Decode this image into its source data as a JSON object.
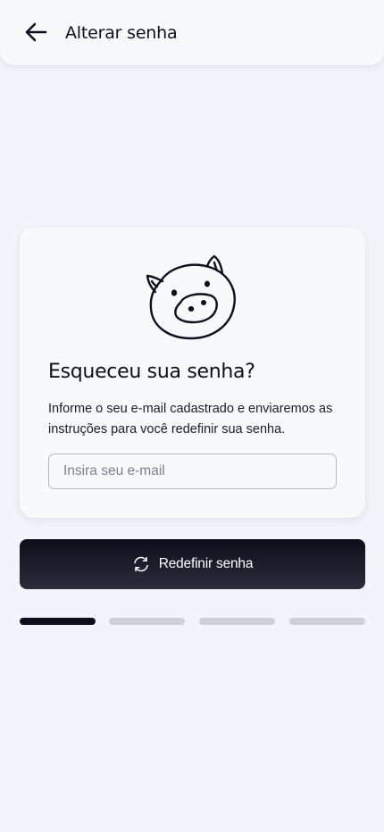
{
  "header": {
    "back_icon": "arrow-left-icon",
    "title": "Alterar senha"
  },
  "card": {
    "illustration": "pig-face-icon",
    "title": "Esqueceu sua senha?",
    "description": "Informe o seu e-mail cadastrado e enviaremos as instruções para você redefinir sua senha.",
    "email_input": {
      "value": "",
      "placeholder": "Insira seu e-mail"
    }
  },
  "submit": {
    "icon": "refresh-icon",
    "label": "Redefinir senha"
  },
  "progress": {
    "steps_total": 4,
    "current_step": 1
  },
  "colors": {
    "background": "#f1f4f8",
    "surface": "#f8f9fb",
    "primary_dark": "#0c0e1a",
    "progress_active": "#0d0f1c",
    "progress_inactive": "#cdd0d5"
  }
}
